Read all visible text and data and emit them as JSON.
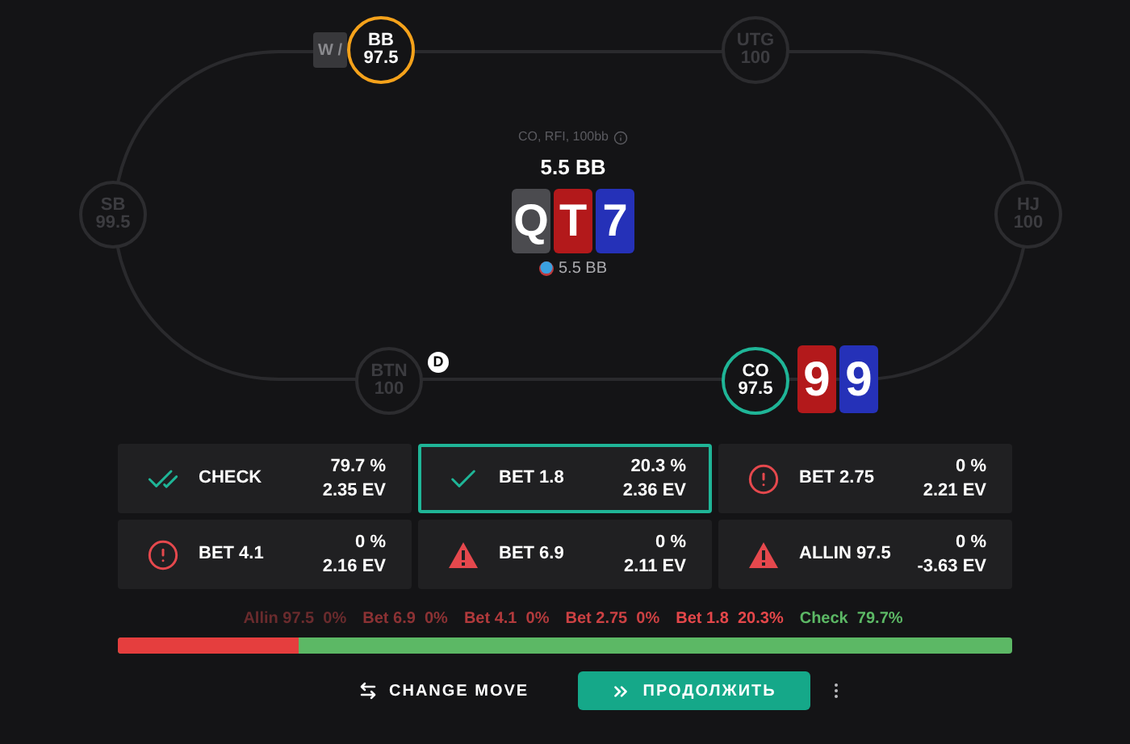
{
  "seats": [
    {
      "position": "BB",
      "stack": "97.5",
      "color": "#f5a21b",
      "badge": "W /"
    },
    {
      "position": "UTG",
      "stack": "100",
      "color": "#2c2c2f"
    },
    {
      "position": "SB",
      "stack": "99.5",
      "color": "#2c2c2f"
    },
    {
      "position": "HJ",
      "stack": "100",
      "color": "#2c2c2f"
    },
    {
      "position": "BTN",
      "stack": "100",
      "color": "#2c2c2f",
      "dealer": "D"
    },
    {
      "position": "CO",
      "stack": "97.5",
      "color": "#1fb597",
      "cards": [
        {
          "rank": "9",
          "color": "#b3191b"
        },
        {
          "rank": "9",
          "color": "#2531b8"
        }
      ]
    }
  ],
  "board": {
    "info": "CO, RFI, 100bb",
    "pot": "5.5 BB",
    "cards": [
      {
        "rank": "Q",
        "color": "#4b4b4f"
      },
      {
        "rank": "T",
        "color": "#b3191b"
      },
      {
        "rank": "7",
        "color": "#2531b8"
      }
    ],
    "chips": "5.5 BB"
  },
  "actions": [
    {
      "kind": "best",
      "label": "CHECK",
      "frequency": "79.7 %",
      "ev": "2.35 EV",
      "selected": false
    },
    {
      "kind": "good",
      "label": "BET 1.8",
      "frequency": "20.3 %",
      "ev": "2.36 EV",
      "selected": true
    },
    {
      "kind": "mistake",
      "label": "BET 2.75",
      "frequency": "0 %",
      "ev": "2.21 EV",
      "selected": false
    },
    {
      "kind": "mistake",
      "label": "BET 4.1",
      "frequency": "0 %",
      "ev": "2.16 EV",
      "selected": false
    },
    {
      "kind": "blunder",
      "label": "BET 6.9",
      "frequency": "0 %",
      "ev": "2.11 EV",
      "selected": false
    },
    {
      "kind": "blunder",
      "label": "ALLIN 97.5",
      "frequency": "0 %",
      "ev": "-3.63 EV",
      "selected": false
    }
  ],
  "frequencies": [
    {
      "label": "Allin 97.5",
      "value": "0%",
      "color": "#6a2b2d"
    },
    {
      "label": "Bet 6.9",
      "value": "0%",
      "color": "#8c3234"
    },
    {
      "label": "Bet 4.1",
      "value": "0%",
      "color": "#b23a3c"
    },
    {
      "label": "Bet 2.75",
      "value": "0%",
      "color": "#cc4143"
    },
    {
      "label": "Bet 1.8",
      "value": "20.3%",
      "color": "#e4474a"
    },
    {
      "label": "Check",
      "value": "79.7%",
      "color": "#5cb865"
    }
  ],
  "strategy_bar": {
    "level": 0.203
  },
  "buttons": {
    "change": "CHANGE MOVE",
    "continue": "ПРОДОЛЖИТЬ"
  }
}
